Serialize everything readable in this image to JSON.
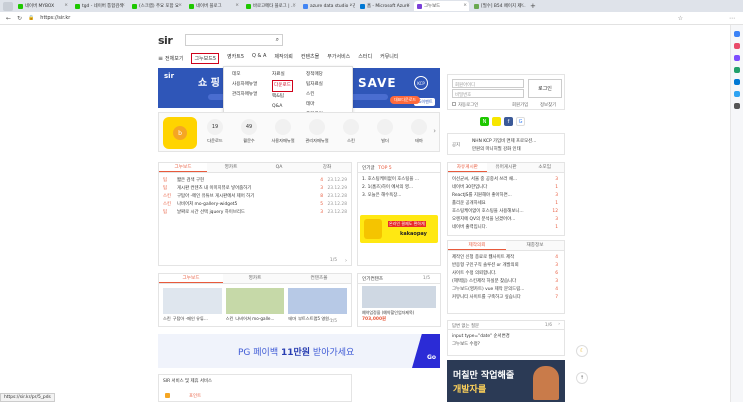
{
  "browser": {
    "tabs": [
      {
        "label": "네이버 MYBOX",
        "color": "#1ec800"
      },
      {
        "label": "tgd - 네이버 통합검색",
        "color": "#1ec800"
      },
      {
        "label": "(스크랩) 주요 포함 요",
        "color": "#1ec800"
      },
      {
        "label": "네이버 블로그",
        "color": "#1ec800"
      },
      {
        "label": "바로고메타 블로그 | ...",
        "color": "#1ec800"
      },
      {
        "label": "azure data studio - 검",
        "color": "#4285f4"
      },
      {
        "label": "홈 - Microsoft Azure",
        "color": "#0078d4"
      },
      {
        "label": "그누보드",
        "color": "#7a3fd8"
      },
      {
        "label": "[필수] B54 페이지 제...",
        "color": "#6aa84f"
      }
    ],
    "url": "https://sir.kr",
    "status": "https://sir.kr/pr/5_pds"
  },
  "header": {
    "logo": "sir",
    "search_placeholder": ""
  },
  "nav": {
    "all": "전체보기",
    "items": [
      "그누보드5",
      "영카트5",
      "Q & A",
      "제작의뢰",
      "컨텐츠몰",
      "부가서비스",
      "스터디",
      "커뮤니티"
    ]
  },
  "submenu": {
    "col1": [
      "데모",
      "사용자매뉴얼",
      "관리자매뉴얼"
    ],
    "col2": [
      "자료실",
      "다운로드",
      "팩&팁",
      "Q&A"
    ],
    "col3": [
      "정적매당",
      "팁자료실",
      "스킨",
      "테마",
      "플러그인",
      "사용후기"
    ]
  },
  "banner": {
    "left": "쇼 핑",
    "mid": "SAVE",
    "tag": "KCP",
    "event": "PG이벤트",
    "badge": "대표다운로드"
  },
  "login": {
    "id_placeholder": "회원아이디",
    "pw_placeholder": "비밀번호",
    "login_btn": "로그인",
    "auto": "자동로그인",
    "signup": "회원가입",
    "find": "정보찾기"
  },
  "quick": {
    "items": [
      "다운로드",
      "월문수",
      "사용자매뉴얼",
      "관리자매뉴얼",
      "스킨",
      "빌더",
      "테마"
    ],
    "badges": [
      "19",
      "49",
      "",
      "",
      "",
      "",
      ""
    ]
  },
  "notice": {
    "label": "공지",
    "line1": "NHN KCP 가입비 면제 프로모션...",
    "line2": "만원의 마니허필 강화 인태"
  },
  "board": {
    "tabs": [
      "그누보드",
      "영카트",
      "QA",
      "강좌"
    ],
    "rows": [
      {
        "cat": "팁",
        "title": "짧은 검색 구현",
        "count": "4",
        "date": "23.12.29"
      },
      {
        "cat": "팁",
        "title": "게시판 컨텐츠 내 이미지뷰로 넣어줍하기",
        "count": "3",
        "date": "23.12.29"
      },
      {
        "cat": "스킨",
        "title": "구탑아 -메인 유튜브 게시판에서 제어 하기",
        "count": "8",
        "date": "23.12.28"
      },
      {
        "cat": "스킨",
        "title": "나비어쳐 mo-gallery-widget5",
        "count": "5",
        "date": "23.12.28"
      },
      {
        "cat": "팁",
        "title": "날짜로 시간 선택 jquery 하이브리드",
        "count": "3",
        "date": "23.12.28"
      }
    ],
    "page": "1/5"
  },
  "popular": {
    "title": "인기글",
    "top": "TOP 5",
    "items": [
      "1. 호스팅케이없이 호스팅을 ...",
      "2. 1(홈즈)하이 에서의 영...",
      "3. 오늘은 해수욕장..."
    ],
    "ad": "온라인 결제도 편하게",
    "ad_brand": "kakaopay"
  },
  "gallery": {
    "tabs": [
      "그누보드",
      "영카트",
      "컨텐츠몰"
    ],
    "items": [
      {
        "cat": "스킨",
        "title": "구탑아 -메인 유튜..."
      },
      {
        "cat": "스킨",
        "title": "나비어쳐 mo-galle..."
      },
      {
        "cat": "테마",
        "title": "부트스트랩5 영원..."
      }
    ],
    "page": "1/5"
  },
  "content_mall": {
    "title": "인기컨텐츠",
    "page": "1/5",
    "item": "예약업정을 (예약할인업자제목)",
    "price": "703,000원"
  },
  "pg_banner": {
    "pre": "PG 페이백 ",
    "hl": "11만원",
    "post": " 받아가세요",
    "go": "Go"
  },
  "bottom": {
    "title": "SIR 서비스 및 제휴 서비스",
    "sub": "포인트"
  },
  "right": {
    "tabs1": [
      "자유게시판",
      "유머게시판",
      "소모임"
    ],
    "list1": [
      {
        "t": "이선균씨, 서울 중 공중서 쓰러 채...",
        "n": "3"
      },
      {
        "t": "네이버 30한입니다",
        "n": "1"
      },
      {
        "t": "ReactJS를 지원해야 좋아하면...",
        "n": "3"
      },
      {
        "t": "홀리운 공개하세요",
        "n": "1"
      },
      {
        "t": "호스팅케이없이 호스팅을 사용해보니...",
        "n": "12"
      },
      {
        "t": "오렌지에 QV의 분석을 남겼어야...",
        "n": "3"
      },
      {
        "t": "네이버 출력입니다.",
        "n": "1"
      }
    ],
    "tabs2": [
      "제작의뢰",
      "재충정보"
    ],
    "list2": [
      {
        "t": "제작인 신청 종료로 웹사이트 제작",
        "n": "4"
      },
      {
        "t": "반응형 구인구직 솔루션 or 개발의뢰",
        "n": "3"
      },
      {
        "t": "사이트 수정 의뢰합니다.",
        "n": "6"
      },
      {
        "t": "(헤택됨) 스킨제작 하실분 찾습니다",
        "n": "3"
      },
      {
        "t": "그누보드(영카트) vue 제작 문의드림...",
        "n": "4"
      },
      {
        "t": "커뮤니티 사이트를 구축하고 싶습니다",
        "n": "7"
      }
    ],
    "qa_title": "답변 없는 질문",
    "qa_page": "1/6",
    "qa_items": [
      "input type=\"date\" 순서변경",
      "그누보드 수정?"
    ],
    "ad_line1": "머칠만 작업해줄",
    "ad_line2": "개발자를"
  }
}
